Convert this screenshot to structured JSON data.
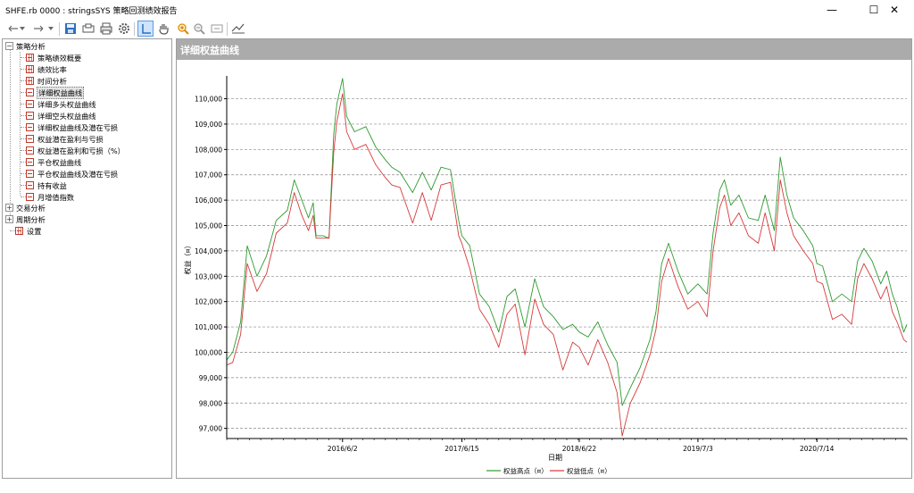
{
  "window": {
    "title": "SHFE.rb 0000 : stringsSYS 策略回测绩效报告"
  },
  "window_controls": {
    "minimize": "—",
    "maximize": "☐",
    "close": "✕"
  },
  "toolbar": {
    "items": [
      "back",
      "forward",
      "save",
      "print-preview",
      "print",
      "settings",
      "cursor",
      "pan",
      "zoom-in",
      "zoom-out",
      "zoom-fit",
      "export"
    ]
  },
  "tree": {
    "root1": "策略分析",
    "items": [
      "策略绩效概要",
      "绩效比率",
      "时间分析",
      "详细权益曲线",
      "详细多头权益曲线",
      "详细空头权益曲线",
      "详细权益曲线及潜在亏损",
      "权益潜在盈利与亏损",
      "权益潜在盈利和亏损（%）",
      "平仓权益曲线",
      "平仓权益曲线及潜在亏损",
      "持有收益",
      "月增值指数"
    ],
    "root2": "交易分析",
    "root3": "周期分析",
    "root4": "设置",
    "expand_plus": "+",
    "expand_minus": "−"
  },
  "panel": {
    "title": "详细权益曲线"
  },
  "chart_data": {
    "type": "line",
    "title": "",
    "xlabel": "日期",
    "ylabel": "权益（¤）",
    "x_ticks": [
      "2016/6/2",
      "2017/6/15",
      "2018/6/22",
      "2019/7/3",
      "2020/7/14"
    ],
    "y_ticks": [
      "97,000",
      "98,000",
      "99,000",
      "100,000",
      "101,000",
      "102,000",
      "103,000",
      "104,000",
      "105,000",
      "106,000",
      "107,000",
      "108,000",
      "109,000",
      "110,000"
    ],
    "ylim": [
      96600,
      110900
    ],
    "grid": "horizontal",
    "legend_position": "bottom-center",
    "series": [
      {
        "name": "权益高点（¤）",
        "color": "#2e9a2e",
        "points": [
          [
            "2015-06-01",
            99700
          ],
          [
            "2015-06-20",
            100000
          ],
          [
            "2015-07-15",
            101200
          ],
          [
            "2015-08-05",
            104200
          ],
          [
            "2015-09-05",
            103000
          ],
          [
            "2015-10-05",
            103800
          ],
          [
            "2015-11-05",
            105200
          ],
          [
            "2015-12-10",
            105600
          ],
          [
            "2016-01-01",
            106800
          ],
          [
            "2016-01-25",
            106000
          ],
          [
            "2016-02-15",
            105300
          ],
          [
            "2016-03-01",
            105900
          ],
          [
            "2016-03-10",
            104600
          ],
          [
            "2016-04-01",
            104600
          ],
          [
            "2016-04-20",
            104500
          ],
          [
            "2016-05-05",
            108600
          ],
          [
            "2016-05-15",
            109800
          ],
          [
            "2016-06-02",
            110800
          ],
          [
            "2016-06-15",
            109300
          ],
          [
            "2016-07-10",
            108700
          ],
          [
            "2016-08-15",
            108900
          ],
          [
            "2016-09-15",
            108100
          ],
          [
            "2016-10-15",
            107600
          ],
          [
            "2016-11-05",
            107300
          ],
          [
            "2016-12-01",
            107100
          ],
          [
            "2017-01-10",
            106300
          ],
          [
            "2017-02-10",
            107100
          ],
          [
            "2017-03-10",
            106400
          ],
          [
            "2017-04-10",
            107300
          ],
          [
            "2017-05-10",
            107200
          ],
          [
            "2017-06-05",
            105200
          ],
          [
            "2017-06-15",
            104600
          ],
          [
            "2017-07-10",
            104200
          ],
          [
            "2017-08-10",
            102300
          ],
          [
            "2017-09-10",
            101800
          ],
          [
            "2017-10-10",
            100800
          ],
          [
            "2017-11-05",
            102200
          ],
          [
            "2017-12-01",
            102500
          ],
          [
            "2018-01-01",
            101000
          ],
          [
            "2018-02-01",
            102900
          ],
          [
            "2018-03-01",
            101800
          ],
          [
            "2018-04-01",
            101400
          ],
          [
            "2018-05-01",
            100900
          ],
          [
            "2018-06-01",
            101100
          ],
          [
            "2018-06-22",
            100800
          ],
          [
            "2018-07-20",
            100600
          ],
          [
            "2018-08-20",
            101200
          ],
          [
            "2018-09-20",
            100300
          ],
          [
            "2018-10-20",
            99600
          ],
          [
            "2018-11-05",
            97900
          ],
          [
            "2018-12-01",
            98600
          ],
          [
            "2019-01-01",
            99400
          ],
          [
            "2019-02-01",
            100500
          ],
          [
            "2019-02-20",
            101600
          ],
          [
            "2019-03-10",
            103500
          ],
          [
            "2019-04-01",
            104300
          ],
          [
            "2019-05-01",
            103200
          ],
          [
            "2019-06-01",
            102300
          ],
          [
            "2019-07-03",
            102700
          ],
          [
            "2019-08-01",
            102300
          ],
          [
            "2019-08-20",
            104700
          ],
          [
            "2019-09-10",
            106400
          ],
          [
            "2019-09-25",
            106800
          ],
          [
            "2019-10-15",
            105800
          ],
          [
            "2019-11-10",
            106200
          ],
          [
            "2019-12-10",
            105300
          ],
          [
            "2020-01-10",
            105200
          ],
          [
            "2020-02-01",
            106200
          ],
          [
            "2020-03-01",
            104800
          ],
          [
            "2020-03-20",
            107700
          ],
          [
            "2020-04-10",
            106200
          ],
          [
            "2020-05-01",
            105300
          ],
          [
            "2020-06-01",
            104800
          ],
          [
            "2020-07-01",
            104200
          ],
          [
            "2020-07-14",
            103500
          ],
          [
            "2020-08-01",
            103400
          ],
          [
            "2020-09-01",
            102000
          ],
          [
            "2020-10-01",
            102300
          ],
          [
            "2020-11-01",
            102000
          ],
          [
            "2020-11-20",
            103600
          ],
          [
            "2020-12-10",
            104100
          ],
          [
            "2021-01-05",
            103600
          ],
          [
            "2021-02-01",
            102700
          ],
          [
            "2021-02-20",
            103200
          ],
          [
            "2021-03-10",
            102300
          ],
          [
            "2021-03-25",
            101800
          ],
          [
            "2021-04-15",
            100800
          ],
          [
            "2021-04-25",
            101100
          ]
        ]
      },
      {
        "name": "权益低点（¤）",
        "color": "#d63a3a",
        "points": [
          [
            "2015-06-01",
            99500
          ],
          [
            "2015-06-20",
            99600
          ],
          [
            "2015-07-15",
            100700
          ],
          [
            "2015-08-05",
            103500
          ],
          [
            "2015-09-05",
            102400
          ],
          [
            "2015-10-05",
            103100
          ],
          [
            "2015-11-05",
            104700
          ],
          [
            "2015-12-10",
            105100
          ],
          [
            "2016-01-01",
            106300
          ],
          [
            "2016-01-25",
            105400
          ],
          [
            "2016-02-15",
            104800
          ],
          [
            "2016-03-01",
            105400
          ],
          [
            "2016-03-10",
            104500
          ],
          [
            "2016-04-01",
            104500
          ],
          [
            "2016-04-20",
            104500
          ],
          [
            "2016-05-05",
            107900
          ],
          [
            "2016-05-15",
            109100
          ],
          [
            "2016-06-02",
            110200
          ],
          [
            "2016-06-15",
            108700
          ],
          [
            "2016-07-10",
            108000
          ],
          [
            "2016-08-15",
            108200
          ],
          [
            "2016-09-15",
            107400
          ],
          [
            "2016-10-15",
            106900
          ],
          [
            "2016-11-05",
            106600
          ],
          [
            "2016-12-01",
            106500
          ],
          [
            "2017-01-10",
            105100
          ],
          [
            "2017-02-10",
            106300
          ],
          [
            "2017-03-10",
            105200
          ],
          [
            "2017-04-10",
            106600
          ],
          [
            "2017-05-10",
            106700
          ],
          [
            "2017-06-05",
            104600
          ],
          [
            "2017-06-15",
            104300
          ],
          [
            "2017-07-10",
            103300
          ],
          [
            "2017-08-10",
            101700
          ],
          [
            "2017-09-10",
            101100
          ],
          [
            "2017-10-10",
            100200
          ],
          [
            "2017-11-05",
            101500
          ],
          [
            "2017-12-01",
            101900
          ],
          [
            "2018-01-01",
            99900
          ],
          [
            "2018-02-01",
            102100
          ],
          [
            "2018-03-01",
            101100
          ],
          [
            "2018-04-01",
            100700
          ],
          [
            "2018-05-01",
            99300
          ],
          [
            "2018-06-01",
            100400
          ],
          [
            "2018-06-22",
            100200
          ],
          [
            "2018-07-20",
            99500
          ],
          [
            "2018-08-20",
            100500
          ],
          [
            "2018-09-20",
            99600
          ],
          [
            "2018-10-20",
            98400
          ],
          [
            "2018-11-05",
            96700
          ],
          [
            "2018-12-01",
            98000
          ],
          [
            "2019-01-01",
            98800
          ],
          [
            "2019-02-01",
            99900
          ],
          [
            "2019-02-20",
            100900
          ],
          [
            "2019-03-10",
            102800
          ],
          [
            "2019-04-01",
            103700
          ],
          [
            "2019-05-01",
            102600
          ],
          [
            "2019-06-01",
            101700
          ],
          [
            "2019-07-03",
            102000
          ],
          [
            "2019-08-01",
            101400
          ],
          [
            "2019-08-20",
            104000
          ],
          [
            "2019-09-10",
            105700
          ],
          [
            "2019-09-25",
            106200
          ],
          [
            "2019-10-15",
            105000
          ],
          [
            "2019-11-10",
            105500
          ],
          [
            "2019-12-10",
            104600
          ],
          [
            "2020-01-10",
            104300
          ],
          [
            "2020-02-01",
            105500
          ],
          [
            "2020-03-01",
            104000
          ],
          [
            "2020-03-20",
            106800
          ],
          [
            "2020-04-10",
            105500
          ],
          [
            "2020-05-01",
            104600
          ],
          [
            "2020-06-01",
            104000
          ],
          [
            "2020-07-01",
            103500
          ],
          [
            "2020-07-14",
            102800
          ],
          [
            "2020-08-01",
            102700
          ],
          [
            "2020-09-01",
            101300
          ],
          [
            "2020-10-01",
            101500
          ],
          [
            "2020-11-01",
            101100
          ],
          [
            "2020-11-20",
            102900
          ],
          [
            "2020-12-10",
            103500
          ],
          [
            "2021-01-05",
            102900
          ],
          [
            "2021-02-01",
            102100
          ],
          [
            "2021-02-20",
            102600
          ],
          [
            "2021-03-10",
            101600
          ],
          [
            "2021-03-25",
            101200
          ],
          [
            "2021-04-15",
            100500
          ],
          [
            "2021-04-25",
            100400
          ]
        ]
      }
    ]
  }
}
